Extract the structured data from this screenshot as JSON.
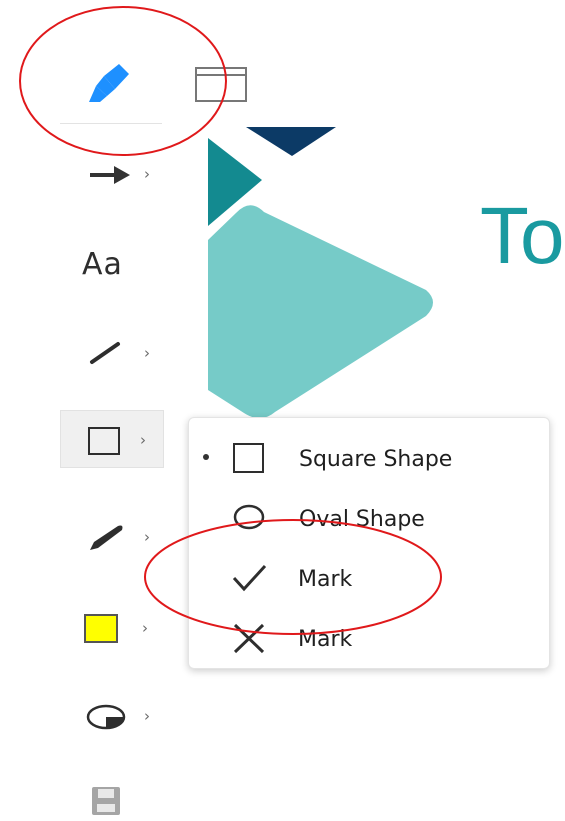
{
  "slide": {
    "title_fragment": "To"
  },
  "toolbar": {
    "text_tool_label": "Aa",
    "chevron": "›",
    "tools": [
      {
        "name": "highlighter",
        "icon": "highlighter-icon",
        "active": true
      },
      {
        "name": "layout",
        "icon": "layout-icon"
      },
      {
        "name": "arrow",
        "icon": "arrow-icon"
      },
      {
        "name": "text",
        "icon": "text-icon"
      },
      {
        "name": "line",
        "icon": "line-icon"
      },
      {
        "name": "shape",
        "icon": "square-shape-icon",
        "selected": true
      },
      {
        "name": "pen",
        "icon": "pen-icon"
      },
      {
        "name": "fill-color",
        "icon": "color-swatch-icon",
        "color": "#ffff00"
      },
      {
        "name": "eraser",
        "icon": "eraser-icon"
      },
      {
        "name": "save",
        "icon": "save-icon"
      }
    ]
  },
  "shape_menu": {
    "items": [
      {
        "label": "Square Shape",
        "icon": "square-shape-icon",
        "selected": true
      },
      {
        "label": "Oval Shape",
        "icon": "oval-shape-icon",
        "selected": false
      },
      {
        "label": "Mark",
        "icon": "check-mark-icon",
        "selected": false
      },
      {
        "label": "Mark",
        "icon": "cross-mark-icon",
        "selected": false
      }
    ]
  },
  "colors": {
    "accent_blue": "#1e90ff",
    "logo_navy": "#0c3a66",
    "logo_teal": "#138a90",
    "logo_light_teal": "#76cbc8",
    "title_teal": "#1a9aa0",
    "swatch_yellow": "#ffff00",
    "annotation_red": "#e0191b"
  }
}
